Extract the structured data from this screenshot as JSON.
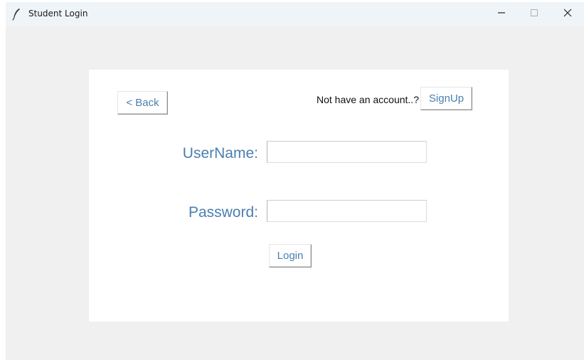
{
  "window": {
    "title": "Student Login",
    "icon": "feather-icon",
    "controls": {
      "minimize": "minimize-icon",
      "maximize": "maximize-icon",
      "close": "close-icon"
    }
  },
  "form": {
    "back_label": "< Back",
    "signup_prompt": "Not have an account..?",
    "signup_label": "SignUp",
    "username_label": "UserName:",
    "username_value": "",
    "password_label": "Password:",
    "password_value": "",
    "login_label": "Login"
  },
  "colors": {
    "accent": "#4a7fb0",
    "window_bg": "#f0f0f0",
    "titlebar_bg": "#eff4f9",
    "panel_bg": "#ffffff"
  }
}
